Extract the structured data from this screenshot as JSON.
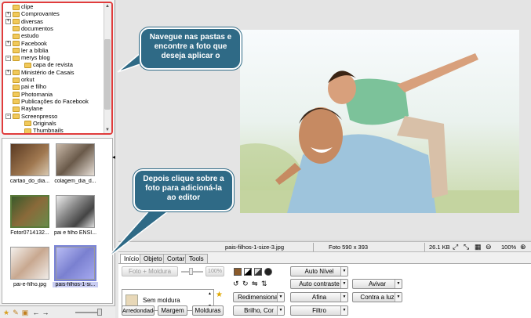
{
  "tree": {
    "items": [
      {
        "label": "clipe",
        "level": 1,
        "expander": ""
      },
      {
        "label": "Comprovantes",
        "level": 1,
        "expander": "+"
      },
      {
        "label": "diversas",
        "level": 1,
        "expander": "+"
      },
      {
        "label": "documentos",
        "level": 1,
        "expander": ""
      },
      {
        "label": "estudo",
        "level": 1,
        "expander": ""
      },
      {
        "label": "Facebook",
        "level": 1,
        "expander": "+"
      },
      {
        "label": "ler a bíblia",
        "level": 1,
        "expander": ""
      },
      {
        "label": "merys blog",
        "level": 1,
        "expander": "−"
      },
      {
        "label": "capa de revista",
        "level": 2,
        "expander": ""
      },
      {
        "label": "Ministério de Casais",
        "level": 1,
        "expander": "+"
      },
      {
        "label": "orkut",
        "level": 1,
        "expander": ""
      },
      {
        "label": "pai e filho",
        "level": 1,
        "expander": ""
      },
      {
        "label": "Photomania",
        "level": 1,
        "expander": ""
      },
      {
        "label": "Publicações do Facebook",
        "level": 1,
        "expander": ""
      },
      {
        "label": "Raylane",
        "level": 1,
        "expander": ""
      },
      {
        "label": "Screenpresso",
        "level": 1,
        "expander": "−"
      },
      {
        "label": "Originals",
        "level": 2,
        "expander": ""
      },
      {
        "label": "Thumbnails",
        "level": 2,
        "expander": ""
      }
    ]
  },
  "thumbnails": [
    {
      "caption": "cartao_do_dia...",
      "color": "#7a5a3c",
      "selected": false
    },
    {
      "caption": "colagem_dia_d...",
      "color": "#b0a090",
      "selected": false
    },
    {
      "caption": "Fotor0714132...",
      "color": "#5a7a3a",
      "selected": false
    },
    {
      "caption": "pai e filho ENSI...",
      "color": "#8a8a8a",
      "selected": false
    },
    {
      "caption": "pai-e-filho.jpg",
      "color": "#d8d0c8",
      "selected": false
    },
    {
      "caption": "pais-filhos-1-si...",
      "color": "#9aa0e8",
      "selected": true
    }
  ],
  "callouts": {
    "top": "Navegue nas pastas e encontre a foto que deseja aplicar o",
    "bottom": "Depois clique sobre a foto para adicioná-la ao editor"
  },
  "status": {
    "filename": "pais-filhos-1-size-3.jpg",
    "dimensions": "Foto 590 x 393",
    "filesize": "26.1 KB",
    "zoom": "100%",
    "zoom2": "100%"
  },
  "editor": {
    "tabs": [
      "Início",
      "Objeto",
      "Cortar",
      "Tools"
    ],
    "foto_moldura": "Foto + Moldura",
    "opacity": "100%",
    "frame_label": "Sem moldura",
    "arredondado": "Arredondado",
    "margem": "Margem",
    "molduras": "Molduras",
    "auto_nivel": "Auto Nível",
    "auto_contraste": "Auto contraste",
    "afina": "Afina",
    "filtro": "Filtro",
    "redimensionar": "Redimensionar",
    "brilho_cor": "Brilho, Cor",
    "avivar": "Avivar",
    "contra_luz": "Contra a luz"
  }
}
